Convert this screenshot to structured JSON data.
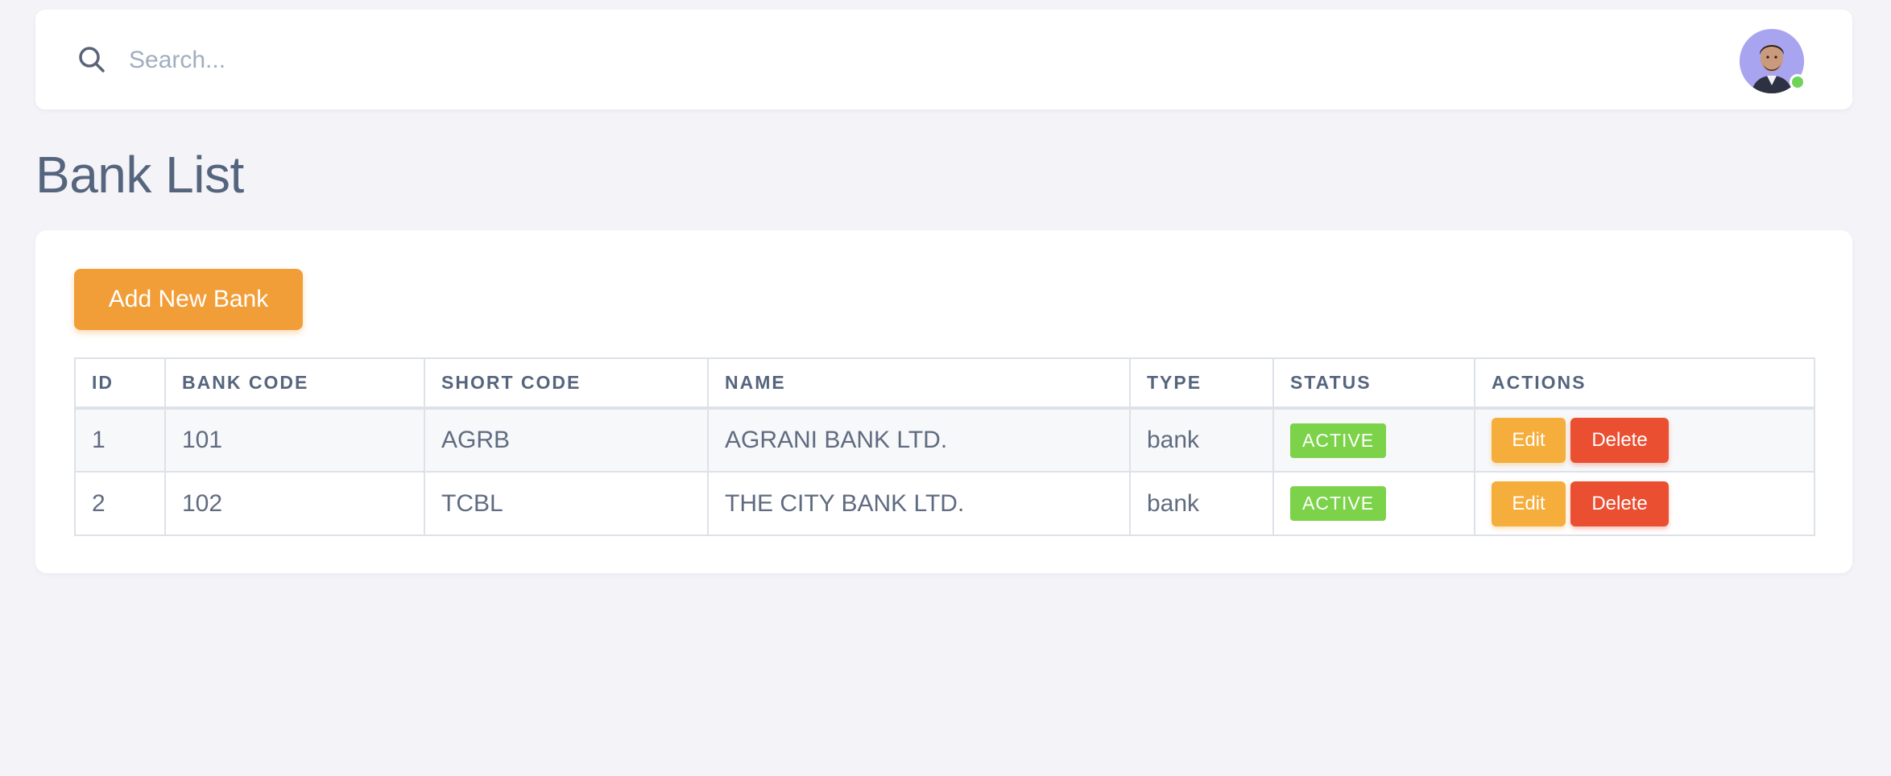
{
  "search": {
    "placeholder": "Search...",
    "value": "",
    "icon": "search-icon"
  },
  "user": {
    "avatar_icon": "user-avatar",
    "online_status_color": "#6fd35a"
  },
  "page": {
    "title": "Bank List"
  },
  "actions": {
    "add_label": "Add New Bank"
  },
  "table": {
    "columns": [
      "ID",
      "BANK CODE",
      "SHORT CODE",
      "NAME",
      "TYPE",
      "STATUS",
      "ACTIONS"
    ],
    "rows": [
      {
        "id": "1",
        "bank_code": "101",
        "short_code": "AGRB",
        "name": "AGRANI BANK LTD.",
        "type": "bank",
        "status": "ACTIVE",
        "edit_label": "Edit",
        "delete_label": "Delete"
      },
      {
        "id": "2",
        "bank_code": "102",
        "short_code": "TCBL",
        "name": "THE CITY BANK LTD.",
        "type": "bank",
        "status": "ACTIVE",
        "edit_label": "Edit",
        "delete_label": "Delete"
      }
    ]
  },
  "colors": {
    "primary_orange": "#f29e38",
    "edit_orange": "#f5ad3b",
    "delete_red": "#ea4f32",
    "active_green": "#7cd34a",
    "background": "#f4f4f8"
  }
}
